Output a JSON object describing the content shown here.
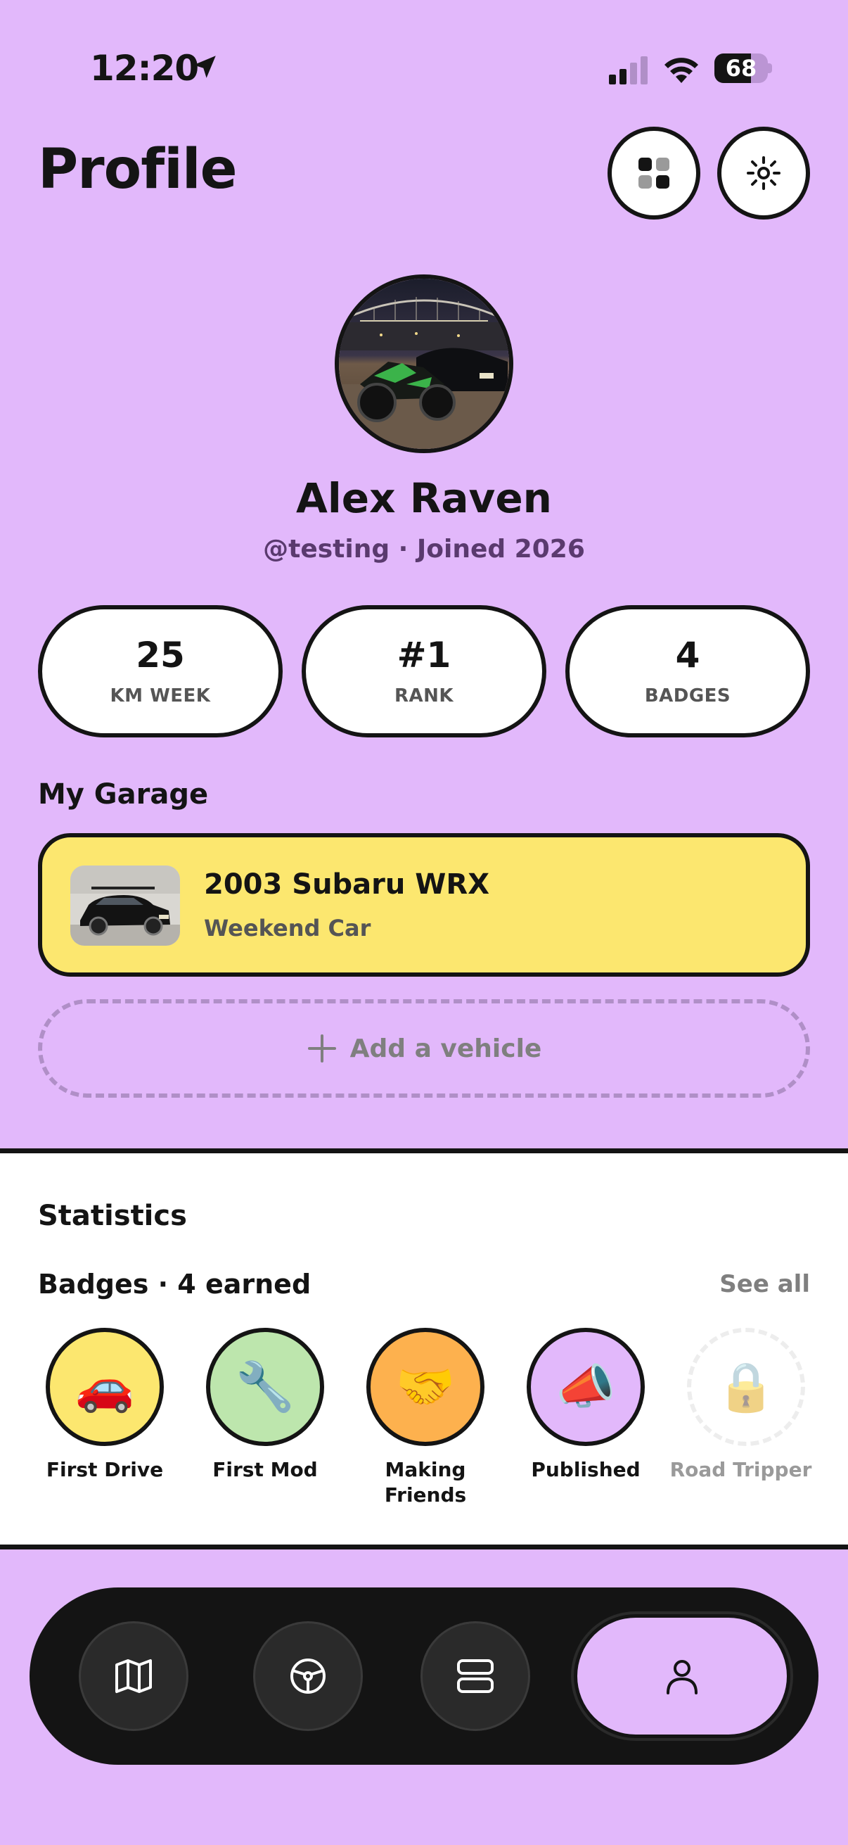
{
  "status_bar": {
    "time": "12:20",
    "battery_percent": "68",
    "battery_level": 0.68,
    "icons": [
      "location-arrow-icon",
      "cellular-signal-icon",
      "wifi-icon",
      "battery-icon"
    ]
  },
  "header": {
    "title": "Profile",
    "buttons": [
      {
        "name": "grid-view",
        "icon": "grid-icon"
      },
      {
        "name": "theme",
        "icon": "sun-icon"
      }
    ]
  },
  "profile": {
    "name": "Alex Raven",
    "meta": "@testing · Joined 2026",
    "avatar_icon": "motorcycle-and-car-photo"
  },
  "stats": [
    {
      "value": "25",
      "label": "KM WEEK"
    },
    {
      "value": "#1",
      "label": "RANK"
    },
    {
      "value": "4",
      "label": "BADGES"
    }
  ],
  "garage": {
    "title": "My Garage",
    "vehicles": [
      {
        "name": "2003 Subaru WRX",
        "subtitle": "Weekend Car",
        "color": "#fce76f"
      }
    ],
    "add_label": "Add a vehicle"
  },
  "statistics": {
    "title": "Statistics",
    "badges_title": "Badges · 4 earned",
    "see_all": "See all",
    "badges": [
      {
        "name": "First Drive",
        "emoji": "🚗",
        "color": "#fce76f",
        "locked": false
      },
      {
        "name": "First Mod",
        "emoji": "🔧",
        "color": "#bde6ad",
        "locked": false
      },
      {
        "name": "Making Friends",
        "emoji": "🤝",
        "color": "#fdb14e",
        "locked": false
      },
      {
        "name": "Published",
        "emoji": "📣",
        "color": "#e2b8fb",
        "locked": false
      },
      {
        "name": "Road Tripper",
        "emoji": "🔒",
        "color": "#ffffff",
        "locked": true
      }
    ]
  },
  "tab_bar": {
    "tabs": [
      {
        "name": "map",
        "icon": "map-icon"
      },
      {
        "name": "drive",
        "icon": "steering-wheel-icon"
      },
      {
        "name": "feed",
        "icon": "stack-icon"
      },
      {
        "name": "profile",
        "icon": "person-icon",
        "active": true
      }
    ]
  }
}
